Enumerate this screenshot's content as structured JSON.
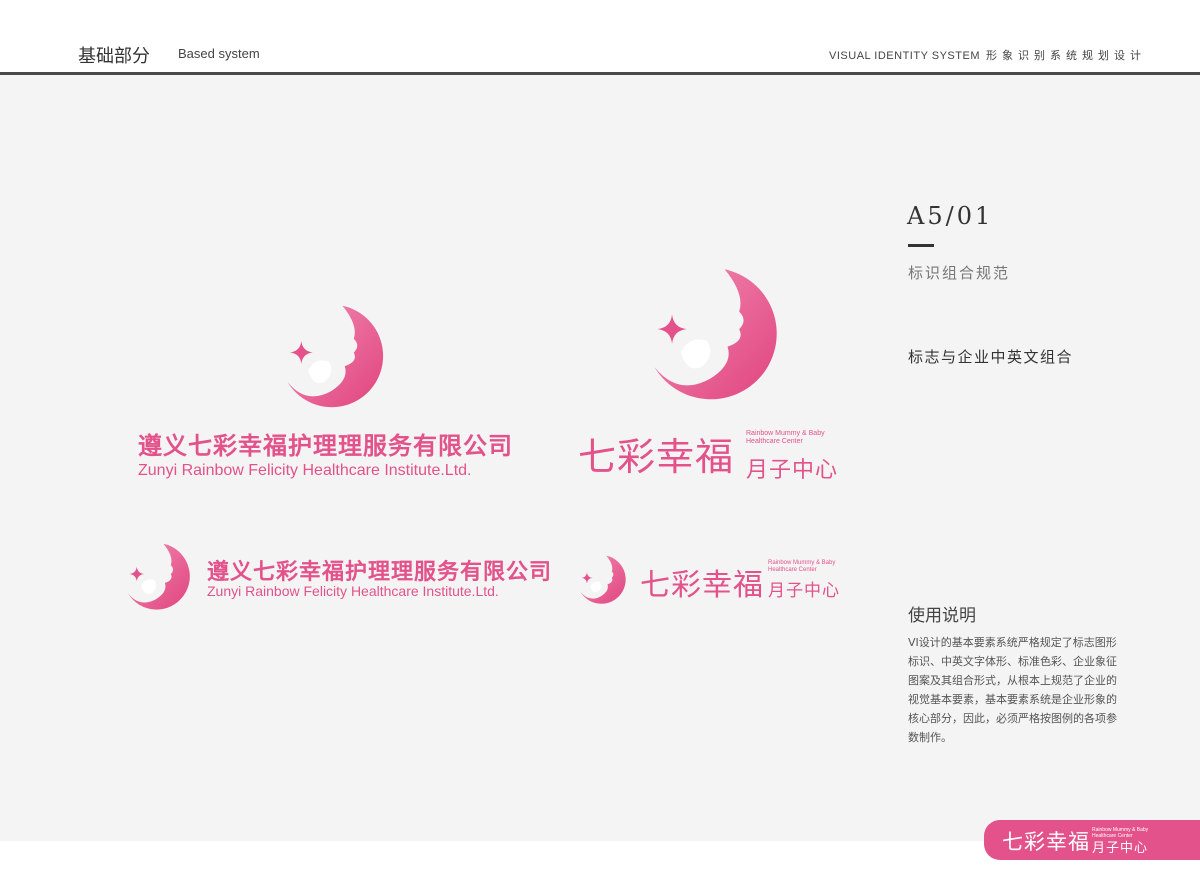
{
  "header": {
    "zh_title": "基础部分",
    "en_title": "Based system",
    "right_en": "VISUAL IDENTITY SYSTEM",
    "right_zh": "形象识别系统规划设计"
  },
  "page": {
    "code": "A5/01",
    "section_name": "标识组合规范",
    "section_sub": "标志与企业中英文组合",
    "usage_title": "使用说明",
    "usage_body": "VI设计的基本要素系统严格规定了标志图形标识、中英文字体形、标准色彩、企业象征图案及其组合形式，从根本上规范了企业的视觉基本要素，基本要素系统是企业形象的核心部分，因此，必须严格按图例的各项参数制作。"
  },
  "logo": {
    "company_zh": "遵义七彩幸福护理理服务有限公司",
    "company_en": "Zunyi Rainbow Felicity Healthcare Institute.Ltd.",
    "brand_zh": "七彩幸福",
    "brand_sub": "月子中心",
    "brand_en_line1": "Rainbow Mummy & Baby",
    "brand_en_line2": "Healthcare Center"
  },
  "colors": {
    "brand_pink": "#e3528a",
    "canvas": "#f4f4f4",
    "rule": "#4a4a4a"
  }
}
